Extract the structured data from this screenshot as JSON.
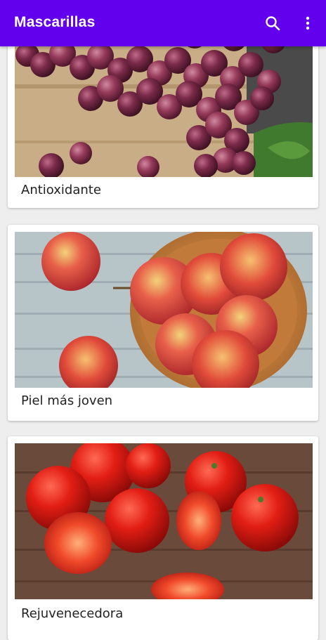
{
  "appbar": {
    "title": "Mascarillas",
    "background": "#6200ee",
    "actions": [
      {
        "icon": "search-icon"
      },
      {
        "icon": "more-vert-icon"
      }
    ]
  },
  "cards": [
    {
      "label": "Antioxidante",
      "image": "red grapes on wooden table"
    },
    {
      "label": "Piel más joven",
      "image": "red apples in wooden bowl"
    },
    {
      "label": "Rejuvenecedora",
      "image": "red tomatoes on wooden table"
    }
  ]
}
